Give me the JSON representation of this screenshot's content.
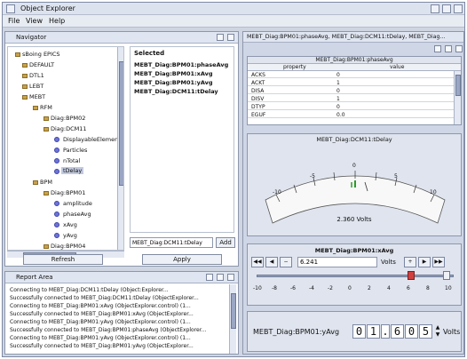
{
  "window": {
    "title": "Object Explorer"
  },
  "menu": [
    "File",
    "View",
    "Help"
  ],
  "navigator": {
    "title": "Navigator",
    "tree": [
      "sBoing EPICS",
      "DEFAULT",
      "DTL1",
      "LEBT",
      "MEBT",
      "RFM",
      "Diag:BPM02",
      "Diag:DCM11",
      "DisplayableElement",
      "Particles",
      "nTotal",
      "tDelay",
      "BPM",
      "Diag:BPM01",
      "amplitude",
      "phaseAvg",
      "xAvg",
      "yAvg",
      "Diag:BPM04"
    ],
    "selected_title": "Selected",
    "selected_items": [
      "MEBT_Diag:BPM01:phaseAvg",
      "MEBT_Diag:BPM01:xAvg",
      "MEBT_Diag:BPM01:yAvg",
      "MEBT_Diag:DCM11:tDelay"
    ],
    "input_value": "MEBT_Diag:DCM11:tDelay",
    "add_label": "Add",
    "refresh_label": "Refresh",
    "apply_label": "Apply"
  },
  "report": {
    "title": "Report Area",
    "lines": [
      "Connecting to MEBT_Diag:DCM11:tDelay (Object:Explorer...",
      "Successfully connected to MEBT_Diag:DCM11:tDelay (ObjectExplorer...",
      "Connecting to MEBT_Diag:BPM01:xAvg (ObjectExplorer.control) (1...",
      "Successfully connected to MEBT_Diag:BPM01:xAvg (ObjectExplorer...",
      "Connecting to MEBT_Diag:BPM01:yAvg (ObjectExplorer.control) (1...",
      "Successfully connected to MEBT_Diag:BPM01:phaseAvg (ObjectExplorer...",
      "Connecting to MEBT_Diag:BPM01:yAvg (ObjectExplorer.control) (1...",
      "Successfully connected to MEBT_Diag:BPM01:yAvg (ObjectExplorer..."
    ]
  },
  "right": {
    "header": "MEBT_Diag:BPM01:phaseAvg, MEBT_Diag:DCM11:tDelay, MEBT_Diag...",
    "table": {
      "title": "MEBT_Diag:BPM01:phaseAvg",
      "headers": [
        "property",
        "value"
      ],
      "rows": [
        [
          "ACKS",
          "0"
        ],
        [
          "ACKT",
          "1"
        ],
        [
          "DISA",
          "0"
        ],
        [
          "DISV",
          "1"
        ],
        [
          "DTYP",
          "0"
        ],
        [
          "EGUF",
          "0.0"
        ]
      ]
    },
    "gauge": {
      "title": "MEBT_Diag:DCM11:tDelay",
      "readout": "2.360 Volts",
      "labels": [
        "-10",
        "-5",
        "0",
        "5",
        "10"
      ]
    },
    "slider": {
      "title": "MEBT_Diag:BPM01:xAvg",
      "field_value": "6.241",
      "unit": "Volts",
      "ticks": [
        "-10",
        "-8",
        "-6",
        "-4",
        "-2",
        "0",
        "2",
        "4",
        "6",
        "8",
        "10"
      ],
      "nav_buttons": [
        "◀◀",
        "◀",
        "−",
        "+",
        "▶",
        "▶▶"
      ]
    },
    "digital": {
      "label": "MEBT_Diag:BPM01:yAvg",
      "digits": [
        "0",
        "1",
        ".",
        "6",
        "0",
        "5"
      ],
      "unit": "Volts"
    }
  }
}
